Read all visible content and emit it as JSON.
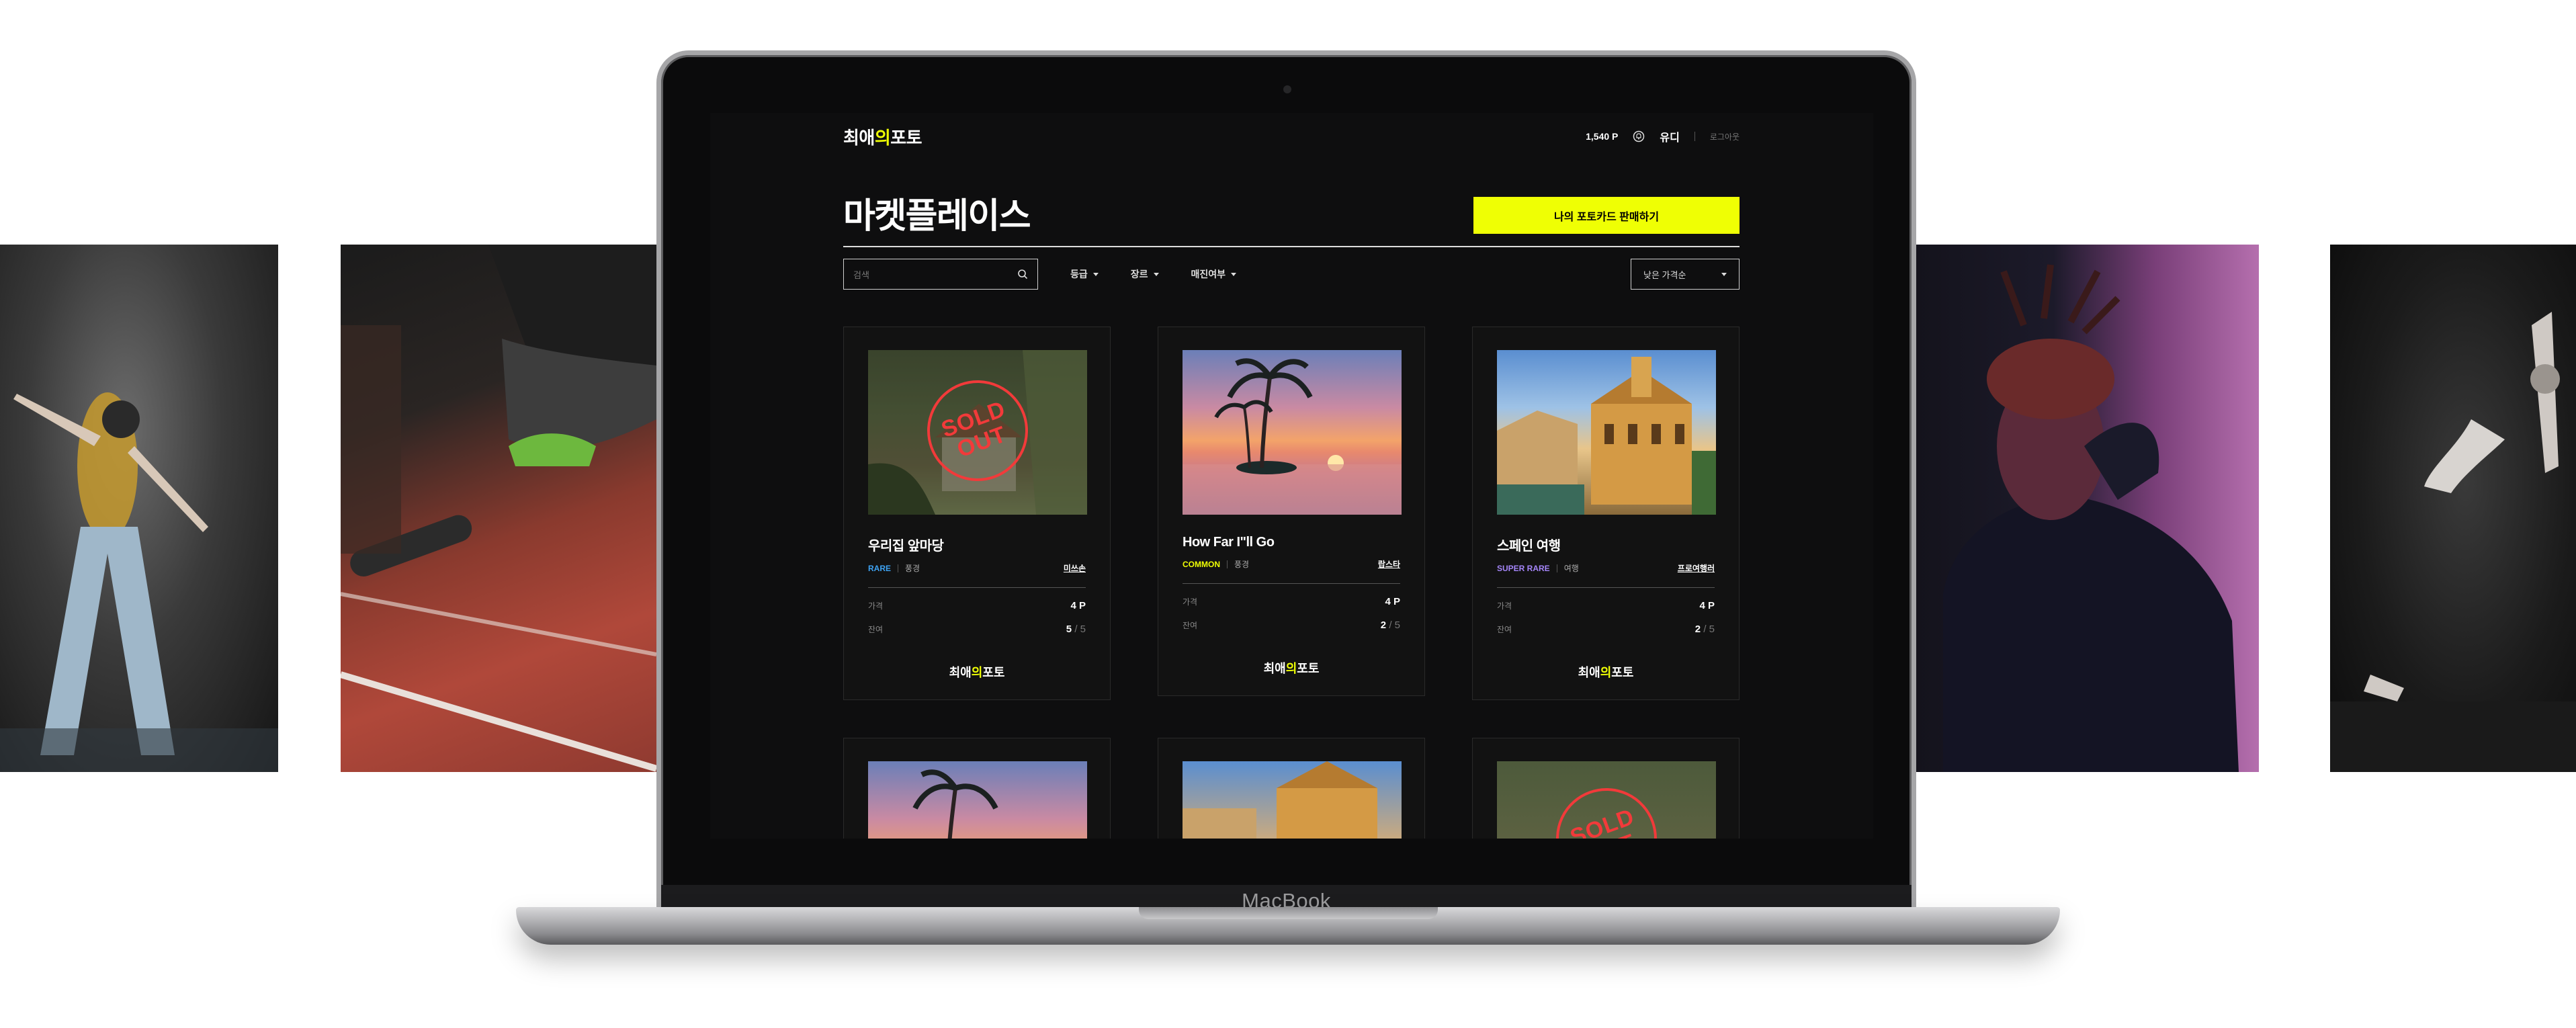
{
  "device": {
    "chin_label": "MacBook"
  },
  "header": {
    "logo": {
      "pre": "최애",
      "highlight": "의",
      "post": "포토"
    },
    "points": "1,540 P",
    "nickname": "유디",
    "logout": "로그아웃"
  },
  "page": {
    "title": "마켓플레이스",
    "sell_button": "나의 포토카드 판매하기"
  },
  "filters": {
    "search_placeholder": "검색",
    "grade": "등급",
    "genre": "장르",
    "soldout": "매진여부",
    "sort": "낮은 가격순"
  },
  "labels": {
    "price": "가격",
    "remain": "잔여",
    "sold_1": "SOLD",
    "sold_2": "OUT"
  },
  "cards": [
    {
      "name": "우리집 앞마당",
      "grade": "RARE",
      "grade_color": "#3ea2f2",
      "genre": "풍경",
      "owner": "미쓰손",
      "price": "4 P",
      "remain": "5",
      "total": "/ 5",
      "sold_out": true
    },
    {
      "name": "How Far I\"ll Go",
      "grade": "COMMON",
      "grade_color": "#efff04",
      "genre": "풍경",
      "owner": "랍스타",
      "price": "4 P",
      "remain": "2",
      "total": "/ 5",
      "sold_out": false
    },
    {
      "name": "스페인 여행",
      "grade": "SUPER RARE",
      "grade_color": "#a485f8",
      "genre": "여행",
      "owner": "프로여행러",
      "price": "4 P",
      "remain": "2",
      "total": "/ 5",
      "sold_out": false
    }
  ],
  "colors": {
    "accent": "#efff04",
    "sold_out": "#f23a3a",
    "bg": "#0e0e0f"
  }
}
